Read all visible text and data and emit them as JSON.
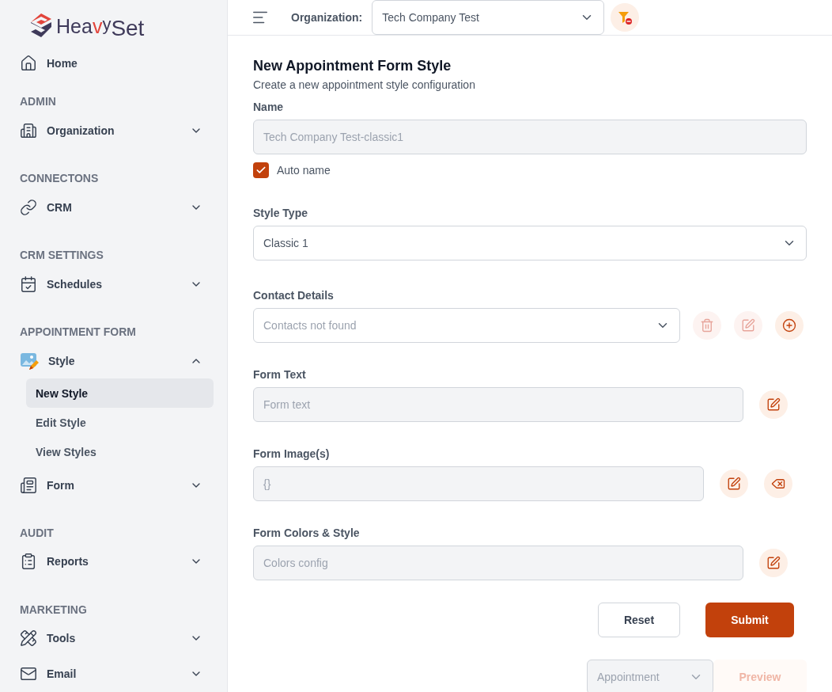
{
  "logo": {
    "parts": [
      {
        "text": "Hea",
        "kind": "plain"
      },
      {
        "text": "v",
        "kind": "accent"
      },
      {
        "text": "y",
        "kind": "raised"
      },
      {
        "text": "Set",
        "kind": "large"
      }
    ]
  },
  "sidebar": {
    "items": [
      {
        "kind": "link",
        "label": "Home"
      },
      {
        "kind": "section",
        "label": "ADMIN"
      },
      {
        "kind": "group",
        "label": "Organization",
        "expanded": false
      },
      {
        "kind": "section",
        "label": "CONNECTONS"
      },
      {
        "kind": "group",
        "label": "CRM",
        "expanded": false
      },
      {
        "kind": "section",
        "label": "CRM SETTINGS"
      },
      {
        "kind": "group",
        "label": "Schedules",
        "expanded": false
      },
      {
        "kind": "section",
        "label": "APPOINTMENT FORM"
      },
      {
        "kind": "group",
        "label": "Style",
        "expanded": true,
        "children": [
          {
            "label": "New Style",
            "selected": true
          },
          {
            "label": "Edit Style",
            "selected": false
          },
          {
            "label": "View Styles",
            "selected": false
          }
        ]
      },
      {
        "kind": "group",
        "label": "Form",
        "expanded": false
      },
      {
        "kind": "section",
        "label": "AUDIT"
      },
      {
        "kind": "group",
        "label": "Reports",
        "expanded": false
      },
      {
        "kind": "section",
        "label": "MARKETING"
      },
      {
        "kind": "group",
        "label": "Tools",
        "expanded": false
      },
      {
        "kind": "group",
        "label": "Email",
        "expanded": false
      }
    ]
  },
  "topbar": {
    "organization_label": "Organization:",
    "organization_value": "Tech Company Test"
  },
  "form": {
    "title": "New Appointment Form Style",
    "subtitle": "Create a new appointment style configuration",
    "fields": [
      {
        "kind": "input",
        "label": "Name",
        "value": "Tech Company Test-classic1",
        "disabled": true,
        "checkbox": {
          "label": "Auto name",
          "checked": true
        }
      },
      {
        "kind": "select",
        "label": "Style Type",
        "value": "Classic 1",
        "disabled": false
      },
      {
        "kind": "select",
        "label": "Contact Details",
        "placeholder": "Contacts not found",
        "disabled": false,
        "buttons": [
          {
            "kind": "delete",
            "disabled": true
          },
          {
            "kind": "edit",
            "disabled": true
          },
          {
            "kind": "add",
            "disabled": false
          }
        ]
      },
      {
        "kind": "input",
        "label": "Form Text",
        "placeholder": "Form text",
        "disabled": true,
        "buttons": [
          {
            "kind": "edit",
            "disabled": false
          }
        ]
      },
      {
        "kind": "input",
        "label": "Form Image(s)",
        "value": "{}",
        "disabled": true,
        "buttons": [
          {
            "kind": "edit",
            "disabled": false
          },
          {
            "kind": "clear",
            "disabled": false
          }
        ]
      },
      {
        "kind": "input",
        "label": "Form Colors & Style",
        "placeholder": "Colors config",
        "disabled": true,
        "buttons": [
          {
            "kind": "edit",
            "disabled": false
          }
        ]
      }
    ],
    "reset": "Reset",
    "submit": "Submit",
    "preview": {
      "select_value": "Appointment",
      "select_disabled": true,
      "button": "Preview",
      "button_disabled": true
    }
  }
}
